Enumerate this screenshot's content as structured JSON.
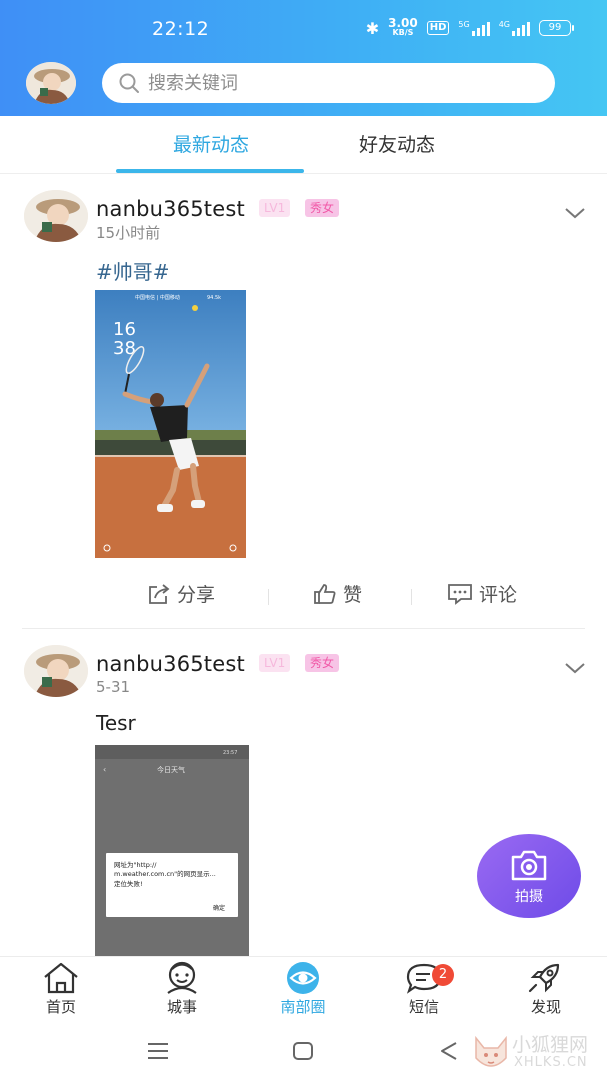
{
  "status_bar": {
    "time": "22:12",
    "speed_value": "3.00",
    "speed_unit": "KB/S",
    "hd": "HD",
    "sim1": "5G",
    "sim2": "4G",
    "battery": "99"
  },
  "header": {
    "search_placeholder": "搜索关键词"
  },
  "tabs": [
    {
      "label": "最新动态",
      "active": true
    },
    {
      "label": "好友动态",
      "active": false
    }
  ],
  "posts": [
    {
      "username": "nanbu365test",
      "level": "LV1",
      "tag": "秀女",
      "time": "15小时前",
      "text": "#帅哥#",
      "image": {
        "carrier": "中国电信 | 中国移动",
        "status": "94.5k",
        "clock_hour": "16",
        "clock_min": "38"
      }
    },
    {
      "username": "nanbu365test",
      "level": "LV1",
      "tag": "秀女",
      "time": "5-31",
      "text": "Tesr",
      "image": {
        "screen_title": "今日天气",
        "status_time": "23:57",
        "dialog_line1": "网址为\"http://",
        "dialog_line2": "m.weather.com.cn\"的网页显示...",
        "dialog_line3": "定位失败!",
        "dialog_button": "确定"
      }
    }
  ],
  "post_actions": {
    "share": "分享",
    "like": "赞",
    "comment": "评论"
  },
  "fab": {
    "label": "拍摄"
  },
  "bottom_nav": [
    {
      "label": "首页",
      "icon": "house-icon"
    },
    {
      "label": "城事",
      "icon": "mascot-icon"
    },
    {
      "label": "南部圈",
      "icon": "circle-eye-icon",
      "active": true
    },
    {
      "label": "短信",
      "icon": "message-icon",
      "badge": "2"
    },
    {
      "label": "发现",
      "icon": "rocket-icon"
    }
  ],
  "watermark": {
    "title": "小狐狸网",
    "site": "XHLKS.CN"
  },
  "colors": {
    "accent": "#2ea7e0",
    "header_start": "#3f8ff6",
    "header_end": "#45c6f3",
    "fab": "#7c56ee",
    "badge_red": "#f04a36"
  }
}
